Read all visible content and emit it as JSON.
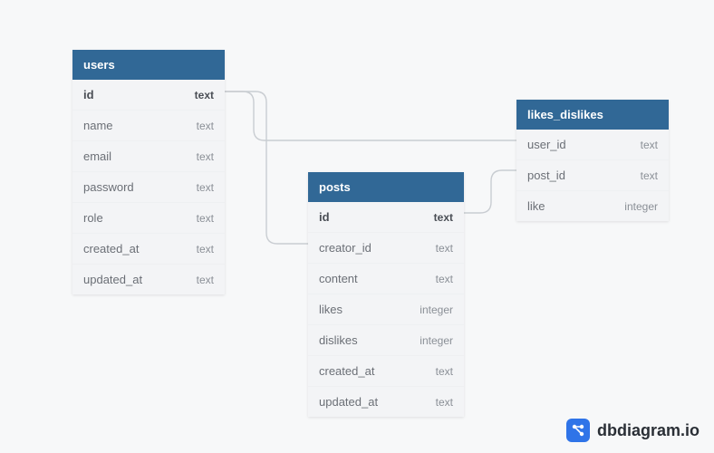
{
  "tables": {
    "users": {
      "name": "users",
      "columns": [
        {
          "name": "id",
          "type": "text",
          "pk": true
        },
        {
          "name": "name",
          "type": "text",
          "pk": false
        },
        {
          "name": "email",
          "type": "text",
          "pk": false
        },
        {
          "name": "password",
          "type": "text",
          "pk": false
        },
        {
          "name": "role",
          "type": "text",
          "pk": false
        },
        {
          "name": "created_at",
          "type": "text",
          "pk": false
        },
        {
          "name": "updated_at",
          "type": "text",
          "pk": false
        }
      ]
    },
    "posts": {
      "name": "posts",
      "columns": [
        {
          "name": "id",
          "type": "text",
          "pk": true
        },
        {
          "name": "creator_id",
          "type": "text",
          "pk": false
        },
        {
          "name": "content",
          "type": "text",
          "pk": false
        },
        {
          "name": "likes",
          "type": "integer",
          "pk": false
        },
        {
          "name": "dislikes",
          "type": "integer",
          "pk": false
        },
        {
          "name": "created_at",
          "type": "text",
          "pk": false
        },
        {
          "name": "updated_at",
          "type": "text",
          "pk": false
        }
      ]
    },
    "likes_dislikes": {
      "name": "likes_dislikes",
      "columns": [
        {
          "name": "user_id",
          "type": "text",
          "pk": false
        },
        {
          "name": "post_id",
          "type": "text",
          "pk": false
        },
        {
          "name": "like",
          "type": "integer",
          "pk": false
        }
      ]
    }
  },
  "relationships": [
    {
      "from_table": "users",
      "from_column": "id",
      "to_table": "posts",
      "to_column": "creator_id"
    },
    {
      "from_table": "users",
      "from_column": "id",
      "to_table": "likes_dislikes",
      "to_column": "user_id"
    },
    {
      "from_table": "posts",
      "from_column": "id",
      "to_table": "likes_dislikes",
      "to_column": "post_id"
    }
  ],
  "brand": {
    "name": "dbdiagram.io"
  },
  "colors": {
    "header": "#316896",
    "row_bg": "#f3f4f6",
    "stroke": "#c9cdd2",
    "brand": "#2f74e8"
  }
}
